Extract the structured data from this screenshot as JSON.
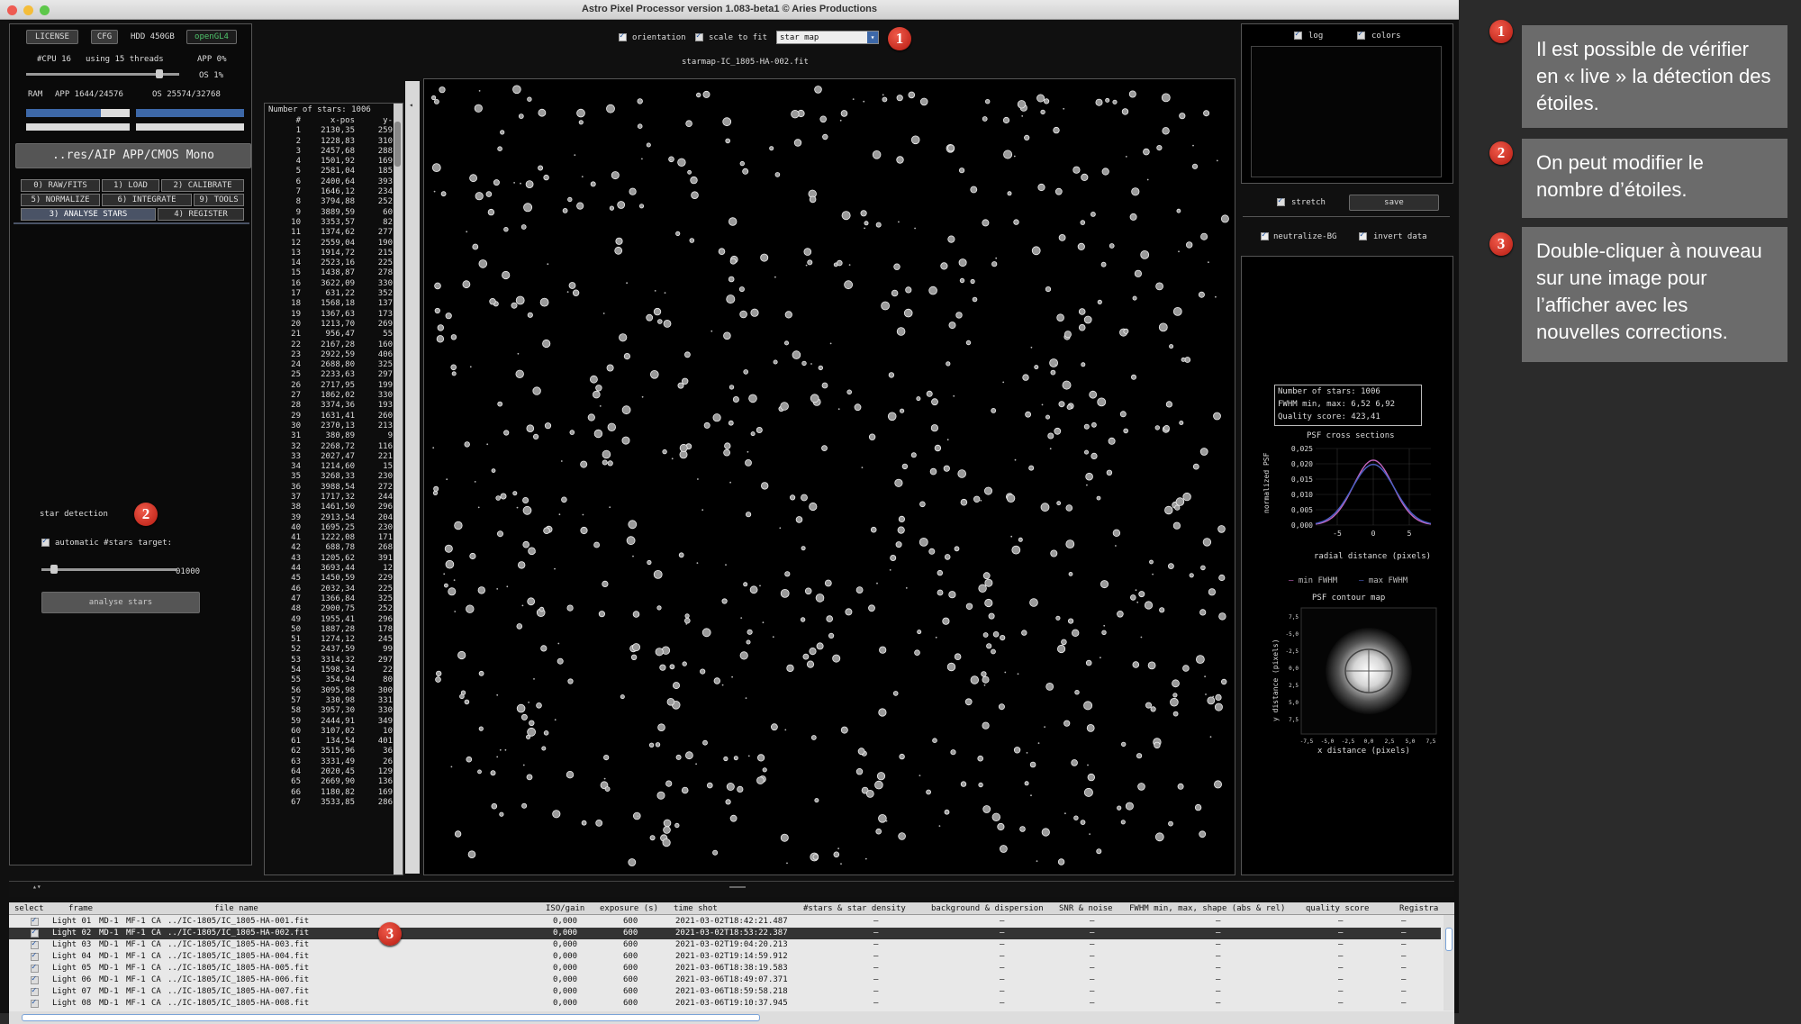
{
  "window": {
    "title": "Astro Pixel Processor version 1.083-beta1 © Aries Productions"
  },
  "top_buttons": {
    "license": "LICENSE",
    "cfg": "CFG",
    "hdd": "HDD 450GB",
    "opengl": "openGL4"
  },
  "cpu": {
    "cpu_label": "#CPU 16",
    "threads": "using 15 threads",
    "app_cpu": "APP 0%",
    "os_cpu": "OS 1%"
  },
  "ram": {
    "label": "RAM",
    "app": "APP 1644/24576",
    "os": "OS 25574/32768"
  },
  "path_button": "..res/AIP APP/CMOS Mono",
  "tabs": [
    {
      "label": "0) RAW/FITS"
    },
    {
      "label": "1) LOAD"
    },
    {
      "label": "2) CALIBRATE"
    },
    {
      "label": "5) NORMALIZE"
    },
    {
      "label": "6) INTEGRATE"
    },
    {
      "label": "9) TOOLS"
    },
    {
      "label": "3) ANALYSE STARS"
    },
    {
      "label": "4) REGISTER"
    }
  ],
  "star_detection": {
    "heading": "star detection",
    "auto_label": "automatic #stars target:",
    "slider_value": "01000",
    "slider_fraction": 0.07,
    "analyse_button": "analyse stars"
  },
  "view_controls": {
    "orientation": "orientation",
    "scale_to_fit": "scale to fit",
    "view_select": "star map",
    "filename": "starmap-IC_1805-HA-002.fit"
  },
  "star_list": {
    "header_title": "Number of stars: 1006",
    "cols": [
      "#",
      "x-pos",
      "y-"
    ],
    "rows": [
      [
        "1",
        "2130,35",
        "259"
      ],
      [
        "2",
        "1228,83",
        "310"
      ],
      [
        "3",
        "2457,68",
        "288"
      ],
      [
        "4",
        "1501,92",
        "169"
      ],
      [
        "5",
        "2581,04",
        "185"
      ],
      [
        "6",
        "2400,64",
        "393"
      ],
      [
        "7",
        "1646,12",
        "234"
      ],
      [
        "8",
        "3794,88",
        "252"
      ],
      [
        "9",
        "3889,59",
        "60"
      ],
      [
        "10",
        "3353,57",
        "82"
      ],
      [
        "11",
        "1374,62",
        "277"
      ],
      [
        "12",
        "2559,04",
        "190"
      ],
      [
        "13",
        "1914,72",
        "215"
      ],
      [
        "14",
        "2523,16",
        "225"
      ],
      [
        "15",
        "1438,87",
        "278"
      ],
      [
        "16",
        "3622,09",
        "330"
      ],
      [
        "17",
        "631,22",
        "352"
      ],
      [
        "18",
        "1568,18",
        "137"
      ],
      [
        "19",
        "1367,63",
        "173"
      ],
      [
        "20",
        "1213,70",
        "269"
      ],
      [
        "21",
        "956,47",
        "55"
      ],
      [
        "22",
        "2167,28",
        "160"
      ],
      [
        "23",
        "2922,59",
        "406"
      ],
      [
        "24",
        "2688,80",
        "325"
      ],
      [
        "25",
        "2233,63",
        "297"
      ],
      [
        "26",
        "2717,95",
        "199"
      ],
      [
        "27",
        "1862,02",
        "330"
      ],
      [
        "28",
        "3374,36",
        "193"
      ],
      [
        "29",
        "1631,41",
        "260"
      ],
      [
        "30",
        "2370,13",
        "213"
      ],
      [
        "31",
        "380,89",
        "9"
      ],
      [
        "32",
        "2268,72",
        "116"
      ],
      [
        "33",
        "2027,47",
        "221"
      ],
      [
        "34",
        "1214,60",
        "15"
      ],
      [
        "35",
        "3268,33",
        "230"
      ],
      [
        "36",
        "3988,54",
        "272"
      ],
      [
        "37",
        "1717,32",
        "244"
      ],
      [
        "38",
        "1461,50",
        "296"
      ],
      [
        "39",
        "2913,54",
        "204"
      ],
      [
        "40",
        "1695,25",
        "230"
      ],
      [
        "41",
        "1222,08",
        "171"
      ],
      [
        "42",
        "688,78",
        "268"
      ],
      [
        "43",
        "1205,62",
        "391"
      ],
      [
        "44",
        "3693,44",
        "12"
      ],
      [
        "45",
        "1450,59",
        "229"
      ],
      [
        "46",
        "2032,34",
        "225"
      ],
      [
        "47",
        "1366,84",
        "325"
      ],
      [
        "48",
        "2900,75",
        "252"
      ],
      [
        "49",
        "1955,41",
        "296"
      ],
      [
        "50",
        "1887,28",
        "178"
      ],
      [
        "51",
        "1274,12",
        "245"
      ],
      [
        "52",
        "2437,59",
        "99"
      ],
      [
        "53",
        "3314,32",
        "297"
      ],
      [
        "54",
        "1598,34",
        "22"
      ],
      [
        "55",
        "354,94",
        "80"
      ],
      [
        "56",
        "3095,98",
        "300"
      ],
      [
        "57",
        "330,98",
        "331"
      ],
      [
        "58",
        "3957,30",
        "330"
      ],
      [
        "59",
        "2444,91",
        "349"
      ],
      [
        "60",
        "3107,02",
        "10"
      ],
      [
        "61",
        "134,54",
        "401"
      ],
      [
        "62",
        "3515,96",
        "36"
      ],
      [
        "63",
        "3331,49",
        "26"
      ],
      [
        "64",
        "2020,45",
        "129"
      ],
      [
        "65",
        "2669,90",
        "136"
      ],
      [
        "66",
        "1180,82",
        "169"
      ],
      [
        "67",
        "3533,85",
        "286"
      ]
    ]
  },
  "right_panel": {
    "log": "log",
    "colors": "colors",
    "stretch": "stretch",
    "save": "save",
    "neutralize": "neutralize-BG",
    "invert": "invert data",
    "info": [
      "Number of stars: 1006",
      "FWHM min, max: 6,52 6,92",
      "Quality score: 423,41"
    ],
    "psf_title": "PSF cross sections",
    "psf_ylabel": "normalized PSF",
    "psf_xlabel": "radial distance (pixels)",
    "psf_yticks": [
      "0,025",
      "0,020",
      "0,015",
      "0,010",
      "0,005",
      "0,000"
    ],
    "psf_xticks": [
      "-5",
      "0",
      "5"
    ],
    "legend_min": "min FWHM",
    "legend_max": "max FWHM",
    "contour_title": "PSF contour map",
    "contour_ylabel": "y distance (pixels)",
    "contour_xlabel": "x distance (pixels)",
    "contour_yticks": [
      "7,5",
      "-5,0",
      "-2,5",
      "0,0",
      "2,5",
      "5,0",
      "7,5"
    ],
    "contour_xticks": [
      "-7,5",
      "-5,0",
      "-2,5",
      "0,0",
      "2,5",
      "5,0",
      "7,5"
    ]
  },
  "file_table": {
    "columns": [
      "select",
      "frame",
      "file name",
      "ISO/gain",
      "exposure (s)",
      "time shot",
      "#stars & star density",
      "background & dispersion",
      "SNR & noise",
      "FWHM min, max, shape (abs & rel)",
      "quality score",
      "Registra"
    ],
    "rows": [
      {
        "frame": "Light 01",
        "md": "MD-1",
        "mf": "MF-1",
        "ca": "CA",
        "file": "../IC-1805/IC_1805-HA-001.fit",
        "iso": "0,000",
        "exp": "600",
        "time": "2021-03-02T18:42:21.487"
      },
      {
        "frame": "Light 02",
        "md": "MD-1",
        "mf": "MF-1",
        "ca": "CA",
        "file": "../IC-1805/IC_1805-HA-002.fit",
        "iso": "0,000",
        "exp": "600",
        "time": "2021-03-02T18:53:22.387"
      },
      {
        "frame": "Light 03",
        "md": "MD-1",
        "mf": "MF-1",
        "ca": "CA",
        "file": "../IC-1805/IC_1805-HA-003.fit",
        "iso": "0,000",
        "exp": "600",
        "time": "2021-03-02T19:04:20.213"
      },
      {
        "frame": "Light 04",
        "md": "MD-1",
        "mf": "MF-1",
        "ca": "CA",
        "file": "../IC-1805/IC_1805-HA-004.fit",
        "iso": "0,000",
        "exp": "600",
        "time": "2021-03-02T19:14:59.912"
      },
      {
        "frame": "Light 05",
        "md": "MD-1",
        "mf": "MF-1",
        "ca": "CA",
        "file": "../IC-1805/IC_1805-HA-005.fit",
        "iso": "0,000",
        "exp": "600",
        "time": "2021-03-06T18:38:19.583"
      },
      {
        "frame": "Light 06",
        "md": "MD-1",
        "mf": "MF-1",
        "ca": "CA",
        "file": "../IC-1805/IC_1805-HA-006.fit",
        "iso": "0,000",
        "exp": "600",
        "time": "2021-03-06T18:49:07.371"
      },
      {
        "frame": "Light 07",
        "md": "MD-1",
        "mf": "MF-1",
        "ca": "CA",
        "file": "../IC-1805/IC_1805-HA-007.fit",
        "iso": "0,000",
        "exp": "600",
        "time": "2021-03-06T18:59:58.218"
      },
      {
        "frame": "Light 08",
        "md": "MD-1",
        "mf": "MF-1",
        "ca": "CA",
        "file": "../IC-1805/IC_1805-HA-008.fit",
        "iso": "0,000",
        "exp": "600",
        "time": "2021-03-06T19:10:37.945"
      }
    ],
    "dash": "–"
  },
  "annotations": [
    {
      "num": "1",
      "text": "Il est possible de vérifier en « live » la détection des étoiles."
    },
    {
      "num": "2",
      "text": "On peut modifier le nombre d’étoiles."
    },
    {
      "num": "3",
      "text": "Double-cliquer à nouveau sur une image pour l’afficher avec les nouvelles corrections."
    }
  ]
}
